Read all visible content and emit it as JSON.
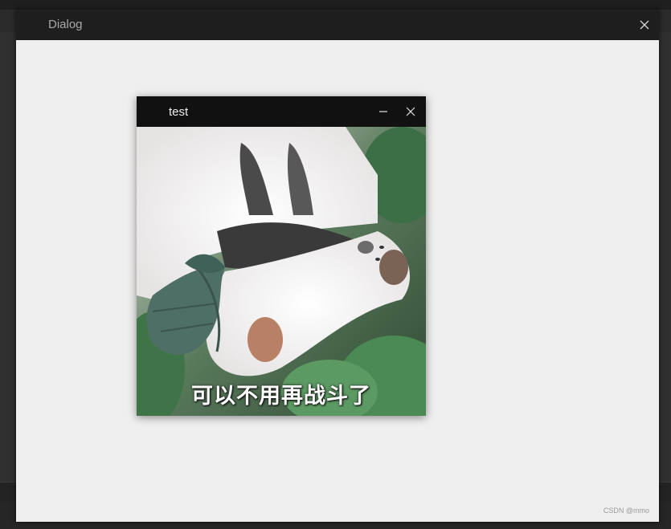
{
  "dialog": {
    "title": "Dialog",
    "close_icon": "close-icon"
  },
  "child_window": {
    "title": "test",
    "minimize_icon": "minimize-icon",
    "close_icon": "close-icon",
    "image": {
      "caption": "可以不用再战斗了",
      "subject": "cats-on-leaves"
    }
  },
  "watermark": "CSDN @mmo",
  "colors": {
    "dialog_titlebar": "#1e1e1e",
    "dialog_body": "#efefef",
    "child_titlebar": "#111111"
  }
}
